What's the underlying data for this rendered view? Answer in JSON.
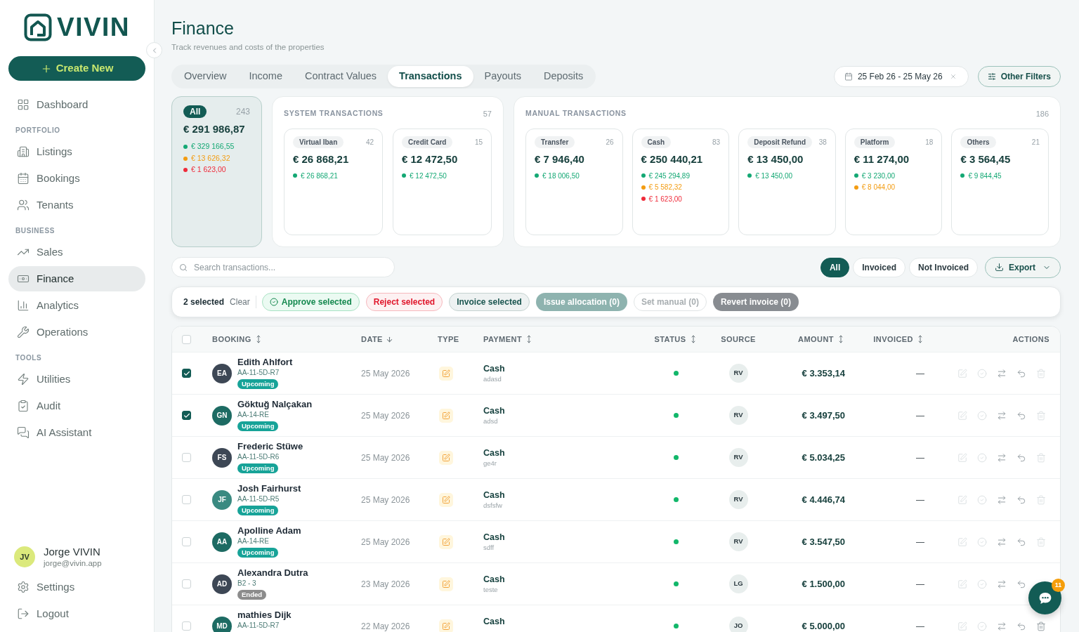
{
  "sidebar": {
    "logo": {
      "text": "VIVIN"
    },
    "create_button": {
      "label": "Create New"
    },
    "sections": [
      {
        "items": [
          {
            "label": "Dashboard",
            "selected": false
          }
        ]
      },
      {
        "heading": "PORTFOLIO",
        "items": [
          {
            "label": "Listings",
            "selected": false
          },
          {
            "label": "Bookings",
            "selected": false
          },
          {
            "label": "Tenants",
            "selected": false
          }
        ]
      },
      {
        "heading": "BUSINESS",
        "items": [
          {
            "label": "Sales",
            "selected": false
          },
          {
            "label": "Finance",
            "selected": true
          },
          {
            "label": "Analytics",
            "selected": false
          },
          {
            "label": "Operations",
            "selected": false
          }
        ]
      },
      {
        "heading": "TOOLS",
        "items": [
          {
            "label": "Utilities",
            "selected": false
          },
          {
            "label": "Audit",
            "selected": false
          },
          {
            "label": "AI Assistant",
            "selected": false
          }
        ]
      }
    ],
    "user": {
      "initials": "JV",
      "name": "Jorge VIVIN",
      "email": "jorge@vivin.app"
    },
    "footer_items": [
      {
        "label": "Settings",
        "selected": false
      },
      {
        "label": "Logout",
        "selected": false
      }
    ]
  },
  "header": {
    "title": "Finance",
    "subtitle": "Track revenues and costs of the properties"
  },
  "tabs": [
    {
      "label": "Overview",
      "selected": false
    },
    {
      "label": "Income",
      "selected": false
    },
    {
      "label": "Contract Values",
      "selected": false
    },
    {
      "label": "Transactions",
      "selected": true
    },
    {
      "label": "Payouts",
      "selected": false
    },
    {
      "label": "Deposits",
      "selected": false
    }
  ],
  "date_filter": {
    "value": "25 Feb 26 - 25 May 26"
  },
  "other_filters": {
    "label": "Other Filters"
  },
  "summary": {
    "all": {
      "label": "All",
      "count": "243",
      "total": "€ 291 986,87",
      "selected": true,
      "breakdown": [
        {
          "amount": "€ 329 166,55",
          "color": "#14a874"
        },
        {
          "amount": "€ 13 626,32",
          "color": "#f39c12"
        },
        {
          "amount": "€ 1 623,00",
          "color": "#ef2b3a"
        }
      ]
    },
    "groups": [
      {
        "title": "SYSTEM TRANSACTIONS",
        "count": "57",
        "cards": [
          {
            "label": "Virtual Iban",
            "count": "42",
            "total": "€ 26 868,21",
            "selected": false,
            "breakdown": [
              {
                "amount": "€ 26 868,21",
                "color": "#14a874"
              }
            ]
          },
          {
            "label": "Credit Card",
            "count": "15",
            "total": "€ 12 472,50",
            "selected": false,
            "breakdown": [
              {
                "amount": "€ 12 472,50",
                "color": "#14a874"
              }
            ]
          }
        ]
      },
      {
        "title": "MANUAL TRANSACTIONS",
        "count": "186",
        "cards": [
          {
            "label": "Transfer",
            "count": "26",
            "total": "€ 7 946,40",
            "selected": false,
            "breakdown": [
              {
                "amount": "€ 18 006,50",
                "color": "#14a874"
              }
            ]
          },
          {
            "label": "Cash",
            "count": "83",
            "total": "€ 250 440,21",
            "selected": false,
            "breakdown": [
              {
                "amount": "€ 245 294,89",
                "color": "#14a874"
              },
              {
                "amount": "€ 5 582,32",
                "color": "#f39c12"
              },
              {
                "amount": "€ 1 623,00",
                "color": "#ef2b3a"
              }
            ]
          },
          {
            "label": "Deposit Refund",
            "count": "38",
            "total": "€ 13 450,00",
            "selected": false,
            "breakdown": [
              {
                "amount": "€ 13 450,00",
                "color": "#14a874"
              }
            ]
          },
          {
            "label": "Platform",
            "count": "18",
            "total": "€ 11 274,00",
            "selected": false,
            "breakdown": [
              {
                "amount": "€ 3 230,00",
                "color": "#14a874"
              },
              {
                "amount": "€ 8 044,00",
                "color": "#f39c12"
              }
            ]
          },
          {
            "label": "Others",
            "count": "21",
            "total": "€ 3 564,45",
            "selected": false,
            "breakdown": [
              {
                "amount": "€ 9 844,45",
                "color": "#14a874"
              }
            ]
          }
        ]
      }
    ]
  },
  "search": {
    "placeholder": "Search transactions..."
  },
  "invoice_filters": [
    {
      "label": "All",
      "selected": true
    },
    {
      "label": "Invoiced",
      "selected": false
    },
    {
      "label": "Not Invoiced",
      "selected": false
    }
  ],
  "export_button": {
    "label": "Export"
  },
  "bulk_bar": {
    "selection": "2 selected",
    "clear": "Clear",
    "actions": [
      {
        "label": "Approve selected",
        "kind": "approve",
        "disabled": false
      },
      {
        "label": "Reject selected",
        "kind": "reject",
        "disabled": false
      },
      {
        "label": "Invoice selected",
        "kind": "invoice",
        "disabled": false
      },
      {
        "label": "Issue allocation (0)",
        "kind": "allocation",
        "disabled": true
      },
      {
        "label": "Set manual (0)",
        "kind": "manual",
        "disabled": true
      },
      {
        "label": "Revert invoice (0)",
        "kind": "revert",
        "disabled": true
      }
    ]
  },
  "table": {
    "all_selected": false,
    "columns": [
      {
        "label": "BOOKING",
        "sortable": true,
        "sorted": false
      },
      {
        "label": "DATE",
        "sortable": true,
        "sorted": true
      },
      {
        "label": "TYPE",
        "sortable": false,
        "sorted": false
      },
      {
        "label": "PAYMENT",
        "sortable": true,
        "sorted": false
      },
      {
        "label": "STATUS",
        "sortable": true,
        "sorted": false
      },
      {
        "label": "SOURCE",
        "sortable": false,
        "sorted": false
      },
      {
        "label": "AMOUNT",
        "sortable": true,
        "sorted": false
      },
      {
        "label": "INVOICED",
        "sortable": true,
        "sorted": false
      },
      {
        "label": "ACTIONS",
        "sortable": false,
        "sorted": false
      }
    ],
    "rows": [
      {
        "selected": true,
        "avatar": {
          "initials": "EA",
          "color": "#3d4755"
        },
        "name": "Edith Ahlfort",
        "code": "AA-11-5D-R7",
        "stage": {
          "label": "Upcoming",
          "kind": "upcoming"
        },
        "date": "25 May 2026",
        "payment": "Cash",
        "payment_note": "adasd",
        "status": {
          "color": "#12b76a"
        },
        "source": "RV",
        "amount": "€ 3.353,14",
        "invoiced": "—",
        "actions": [
          {
            "kind": "edit",
            "disabled": true
          },
          {
            "kind": "approve",
            "disabled": true
          },
          {
            "kind": "transfer",
            "disabled": false
          },
          {
            "kind": "undo",
            "disabled": false
          },
          {
            "kind": "delete",
            "disabled": true
          }
        ]
      },
      {
        "selected": true,
        "avatar": {
          "initials": "GN",
          "color": "#1d6b63"
        },
        "name": "Göktuğ Nalçakan",
        "code": "AA-14-RE",
        "stage": {
          "label": "Upcoming",
          "kind": "upcoming"
        },
        "date": "25 May 2026",
        "payment": "Cash",
        "payment_note": "adsd",
        "status": {
          "color": "#12b76a"
        },
        "source": "RV",
        "amount": "€ 3.497,50",
        "invoiced": "—",
        "actions": [
          {
            "kind": "edit",
            "disabled": true
          },
          {
            "kind": "approve",
            "disabled": true
          },
          {
            "kind": "transfer",
            "disabled": false
          },
          {
            "kind": "undo",
            "disabled": false
          },
          {
            "kind": "delete",
            "disabled": true
          }
        ]
      },
      {
        "selected": false,
        "avatar": {
          "initials": "FS",
          "color": "#3d4755"
        },
        "name": "Frederic Stüwe",
        "code": "AA-11-5D-R6",
        "stage": {
          "label": "Upcoming",
          "kind": "upcoming"
        },
        "date": "25 May 2026",
        "payment": "Cash",
        "payment_note": "ge4r",
        "status": {
          "color": "#12b76a"
        },
        "source": "RV",
        "amount": "€ 5.034,25",
        "invoiced": "—",
        "actions": [
          {
            "kind": "edit",
            "disabled": true
          },
          {
            "kind": "approve",
            "disabled": true
          },
          {
            "kind": "transfer",
            "disabled": false
          },
          {
            "kind": "undo",
            "disabled": false
          },
          {
            "kind": "delete",
            "disabled": true
          }
        ]
      },
      {
        "selected": false,
        "avatar": {
          "initials": "JF",
          "color": "#3a8a81"
        },
        "name": "Josh Fairhurst",
        "code": "AA-11-5D-R5",
        "stage": {
          "label": "Upcoming",
          "kind": "upcoming"
        },
        "date": "25 May 2026",
        "payment": "Cash",
        "payment_note": "dsfsfw",
        "status": {
          "color": "#12b76a"
        },
        "source": "RV",
        "amount": "€ 4.446,74",
        "invoiced": "—",
        "actions": [
          {
            "kind": "edit",
            "disabled": true
          },
          {
            "kind": "approve",
            "disabled": true
          },
          {
            "kind": "transfer",
            "disabled": false
          },
          {
            "kind": "undo",
            "disabled": false
          },
          {
            "kind": "delete",
            "disabled": true
          }
        ]
      },
      {
        "selected": false,
        "avatar": {
          "initials": "AA",
          "color": "#1d6b63"
        },
        "name": "Apolline Adam",
        "code": "AA-14-RE",
        "stage": {
          "label": "Upcoming",
          "kind": "upcoming"
        },
        "date": "25 May 2026",
        "payment": "Cash",
        "payment_note": "sdff",
        "status": {
          "color": "#12b76a"
        },
        "source": "RV",
        "amount": "€ 3.547,50",
        "invoiced": "—",
        "actions": [
          {
            "kind": "edit",
            "disabled": true
          },
          {
            "kind": "approve",
            "disabled": true
          },
          {
            "kind": "transfer",
            "disabled": false
          },
          {
            "kind": "undo",
            "disabled": false
          },
          {
            "kind": "delete",
            "disabled": true
          }
        ]
      },
      {
        "selected": false,
        "avatar": {
          "initials": "AD",
          "color": "#3d4755"
        },
        "name": "Alexandra Dutra",
        "code": "B2 - 3",
        "stage": {
          "label": "Ended",
          "kind": "ended"
        },
        "date": "23 May 2026",
        "payment": "Cash",
        "payment_note": "teste",
        "status": {
          "color": "#12b76a"
        },
        "source": "LG",
        "amount": "€ 1.500,00",
        "invoiced": "—",
        "actions": [
          {
            "kind": "edit",
            "disabled": true
          },
          {
            "kind": "approve",
            "disabled": true
          },
          {
            "kind": "transfer",
            "disabled": false
          },
          {
            "kind": "undo",
            "disabled": false
          }
        ]
      },
      {
        "selected": false,
        "avatar": {
          "initials": "MD",
          "color": "#1d6b63"
        },
        "name": "mathies Dijk",
        "code": "AA-11-5D-R7",
        "date": "22 May 2026",
        "payment": "Cash",
        "status": {
          "color": "#12b76a"
        },
        "source": "JO",
        "amount": "€ 5.000,00",
        "invoiced": "—",
        "actions": [
          {
            "kind": "edit",
            "disabled": true
          },
          {
            "kind": "approve",
            "disabled": true
          },
          {
            "kind": "transfer",
            "disabled": false
          },
          {
            "kind": "undo",
            "disabled": false
          },
          {
            "kind": "delete",
            "disabled": false
          }
        ]
      }
    ]
  },
  "chat": {
    "badge": "11"
  }
}
